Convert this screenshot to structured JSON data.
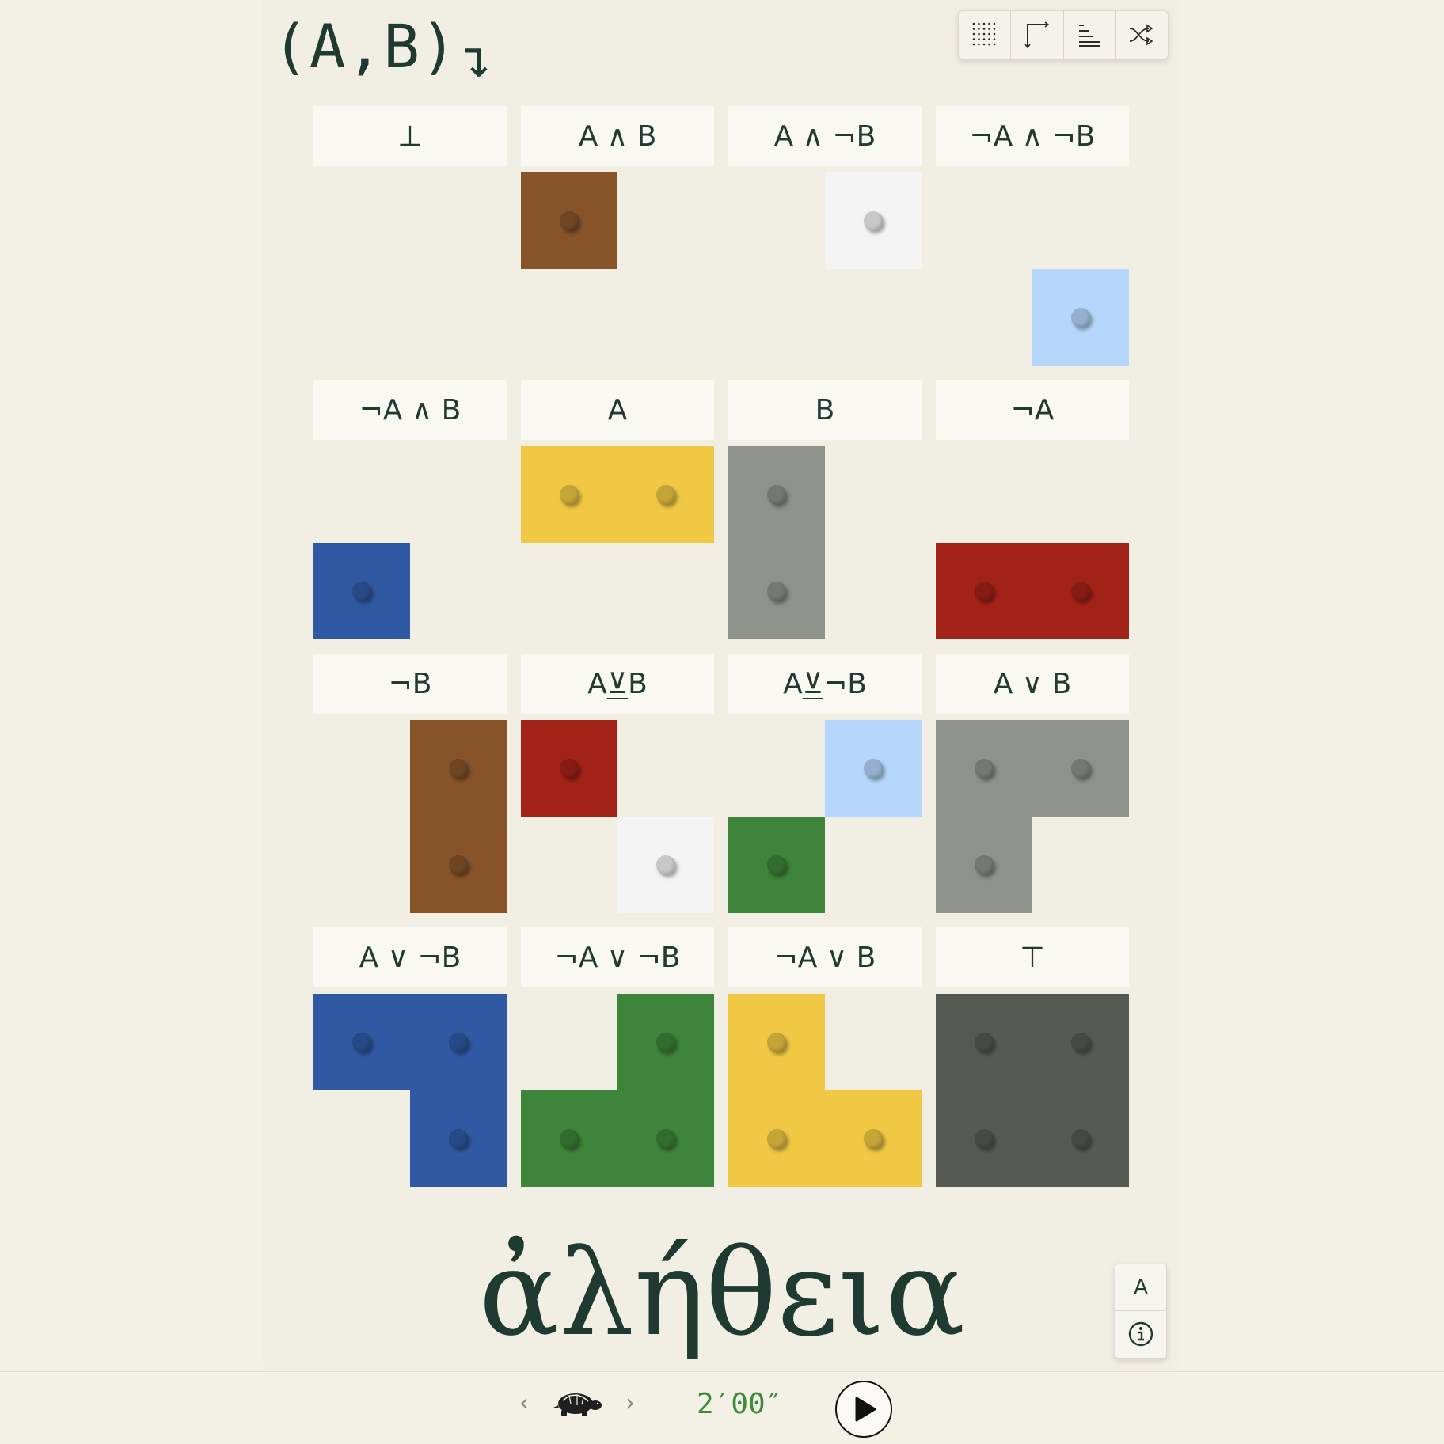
{
  "header": {
    "title": "(A,B)",
    "arrow": "↴"
  },
  "toolbar": [
    "dots-grid-icon",
    "corner-arrow-icon",
    "align-lines-icon",
    "shuffle-icon"
  ],
  "palette": {
    "brown": "#87542a",
    "white": "#f4f4f4",
    "lightblue": "#b6d7fb",
    "blue": "#3059a3",
    "yellow": "#f0c844",
    "gray": "#8d928c",
    "red": "#a32218",
    "green": "#3e843a",
    "darkgray": "#555a55"
  },
  "cells": [
    {
      "label": "⊥",
      "squares": []
    },
    {
      "label": "A ∧ B",
      "squares": [
        {
          "pos": "tl",
          "color": "brown"
        }
      ]
    },
    {
      "label": "A ∧ ¬B",
      "squares": [
        {
          "pos": "tr",
          "color": "white"
        }
      ]
    },
    {
      "label": "¬A ∧ ¬B",
      "squares": [
        {
          "pos": "br",
          "color": "lightblue"
        }
      ]
    },
    {
      "label": "¬A ∧ B",
      "squares": [
        {
          "pos": "bl",
          "color": "blue"
        }
      ]
    },
    {
      "label": "A",
      "squares": [
        {
          "pos": "tl",
          "color": "yellow"
        },
        {
          "pos": "tr",
          "color": "yellow"
        }
      ]
    },
    {
      "label": "B",
      "squares": [
        {
          "pos": "tl",
          "color": "gray"
        },
        {
          "pos": "bl",
          "color": "gray"
        }
      ]
    },
    {
      "label": "¬A",
      "squares": [
        {
          "pos": "bl",
          "color": "red"
        },
        {
          "pos": "br",
          "color": "red"
        }
      ]
    },
    {
      "label": "¬B",
      "squares": [
        {
          "pos": "tr",
          "color": "brown"
        },
        {
          "pos": "br",
          "color": "brown"
        }
      ]
    },
    {
      "label": "A ⊻ B",
      "underline": "⊻",
      "squares": [
        {
          "pos": "tl",
          "color": "red"
        },
        {
          "pos": "br",
          "color": "white"
        }
      ]
    },
    {
      "label": "A ⊻ ¬B",
      "underline": "⊻",
      "squares": [
        {
          "pos": "tr",
          "color": "lightblue"
        },
        {
          "pos": "bl",
          "color": "green"
        }
      ]
    },
    {
      "label": "A ∨ B",
      "squares": [
        {
          "pos": "tl",
          "color": "gray"
        },
        {
          "pos": "tr",
          "color": "gray"
        },
        {
          "pos": "bl",
          "color": "gray"
        }
      ]
    },
    {
      "label": "A ∨ ¬B",
      "squares": [
        {
          "pos": "tl",
          "color": "blue"
        },
        {
          "pos": "tr",
          "color": "blue"
        },
        {
          "pos": "br",
          "color": "blue"
        }
      ]
    },
    {
      "label": "¬A ∨ ¬B",
      "squares": [
        {
          "pos": "tr",
          "color": "green"
        },
        {
          "pos": "bl",
          "color": "green"
        },
        {
          "pos": "br",
          "color": "green"
        }
      ]
    },
    {
      "label": "¬A ∨ B",
      "squares": [
        {
          "pos": "tl",
          "color": "yellow"
        },
        {
          "pos": "bl",
          "color": "yellow"
        },
        {
          "pos": "br",
          "color": "yellow"
        }
      ]
    },
    {
      "label": "⊤",
      "squares": [
        {
          "pos": "tl",
          "color": "darkgray"
        },
        {
          "pos": "tr",
          "color": "darkgray"
        },
        {
          "pos": "bl",
          "color": "darkgray"
        },
        {
          "pos": "br",
          "color": "darkgray"
        }
      ]
    }
  ],
  "brand": "ἀλήθεια",
  "side": {
    "font_button": "A",
    "info_icon": "info-icon"
  },
  "footer": {
    "prev_icon": "chevron-left-icon",
    "speed_icon": "turtle-icon",
    "next_icon": "chevron-right-icon",
    "time": "2′00″",
    "play_icon": "play-icon"
  }
}
